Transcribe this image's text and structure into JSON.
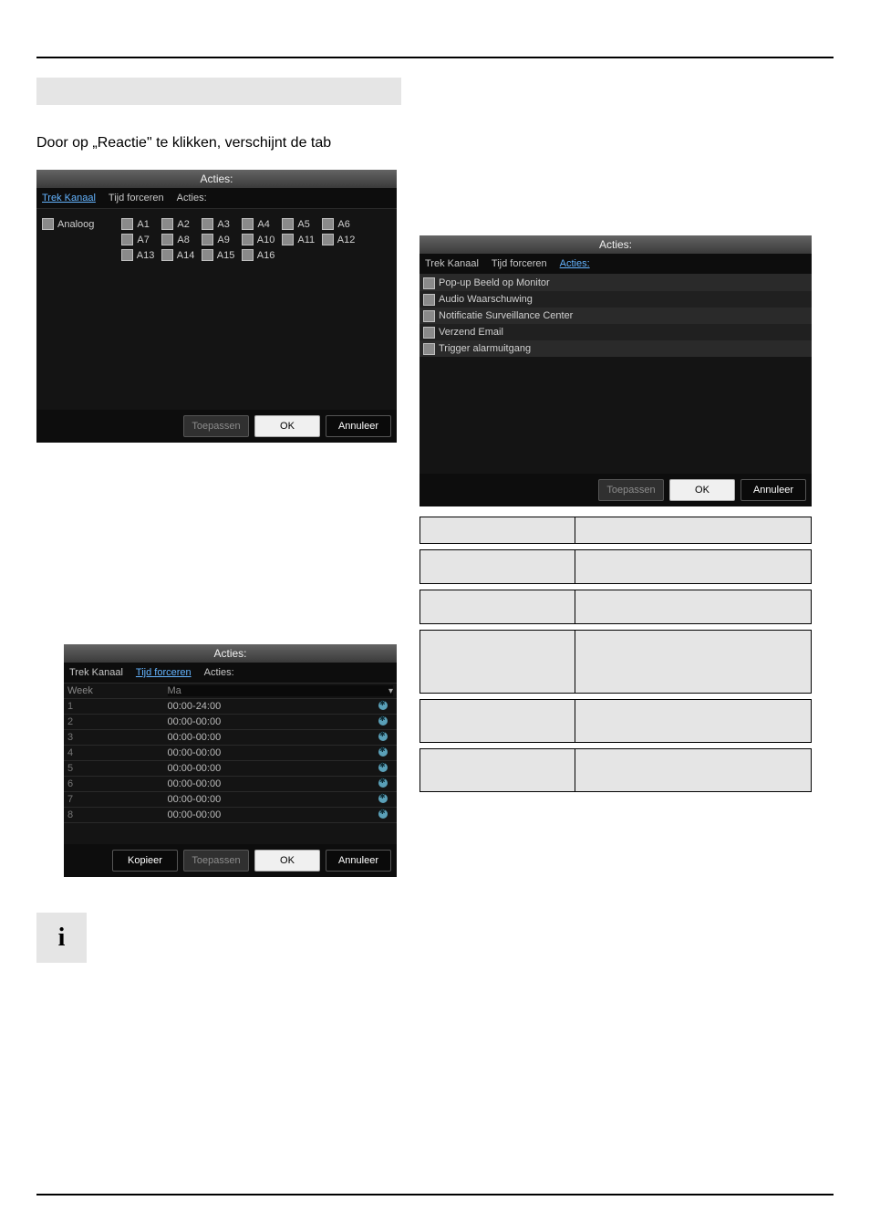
{
  "intro_text": "Door op „Reactie\" te klikken, verschijnt de tab",
  "panel1": {
    "title": "Acties:",
    "tabs": [
      {
        "label": "Trek Kanaal",
        "active": true
      },
      {
        "label": "Tijd forceren",
        "active": false
      },
      {
        "label": "Acties:",
        "active": false
      }
    ],
    "row_label": "Analoog",
    "channels": [
      "A1",
      "A2",
      "A3",
      "A4",
      "A5",
      "A6",
      "A7",
      "A8",
      "A9",
      "A10",
      "A11",
      "A12",
      "A13",
      "A14",
      "A15",
      "A16"
    ],
    "buttons": {
      "apply": "Toepassen",
      "ok": "OK",
      "cancel": "Annuleer"
    }
  },
  "panel2": {
    "title": "Acties:",
    "tabs": [
      {
        "label": "Trek Kanaal",
        "active": false
      },
      {
        "label": "Tijd forceren",
        "active": false
      },
      {
        "label": "Acties:",
        "active": true
      }
    ],
    "actions": [
      "Pop-up Beeld op Monitor",
      "Audio Waarschuwing",
      "Notificatie Surveillance Center",
      "Verzend Email",
      "Trigger alarmuitgang"
    ],
    "buttons": {
      "apply": "Toepassen",
      "ok": "OK",
      "cancel": "Annuleer"
    }
  },
  "panel3": {
    "title": "Acties:",
    "tabs": [
      {
        "label": "Trek Kanaal",
        "active": false
      },
      {
        "label": "Tijd forceren",
        "active": true
      },
      {
        "label": "Acties:",
        "active": false
      }
    ],
    "week_label": "Week",
    "day_label": "Ma",
    "rows": [
      {
        "n": "1",
        "time": "00:00-24:00"
      },
      {
        "n": "2",
        "time": "00:00-00:00"
      },
      {
        "n": "3",
        "time": "00:00-00:00"
      },
      {
        "n": "4",
        "time": "00:00-00:00"
      },
      {
        "n": "5",
        "time": "00:00-00:00"
      },
      {
        "n": "6",
        "time": "00:00-00:00"
      },
      {
        "n": "7",
        "time": "00:00-00:00"
      },
      {
        "n": "8",
        "time": "00:00-00:00"
      }
    ],
    "buttons": {
      "copy": "Kopieer",
      "apply": "Toepassen",
      "ok": "OK",
      "cancel": "Annuleer"
    }
  },
  "skeleton_rows": [
    30,
    38,
    38,
    70,
    48,
    48
  ],
  "info_icon": "i"
}
